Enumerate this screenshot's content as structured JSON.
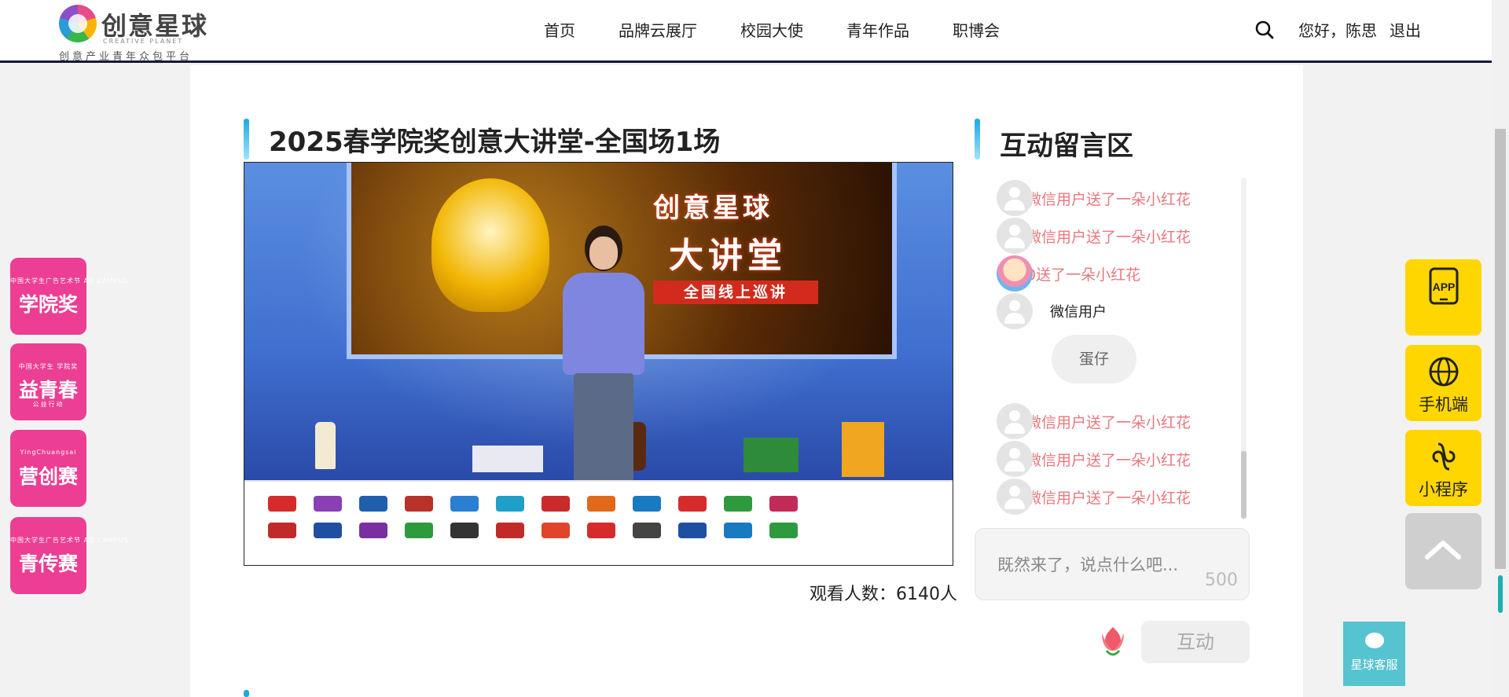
{
  "header": {
    "logo_title": "创意星球",
    "logo_en": "CREATIVE PLANET",
    "logo_sub": "创意产业青年众包平台",
    "nav": [
      "首页",
      "品牌云展厅",
      "校园大使",
      "青年作品",
      "职博会"
    ],
    "greeting": "您好，陈思",
    "logout": "退出"
  },
  "live": {
    "title": "2025春学院奖创意大讲堂-全国场1场",
    "screen_brand_line1": "创意星球",
    "screen_brand_line2": "大讲堂",
    "screen_tour": "全国线上巡讲",
    "viewers": "观看人数：6140人"
  },
  "chat": {
    "title": "互动留言区",
    "messages": [
      {
        "text": "微信用户送了一朵小红花",
        "type": "gift"
      },
      {
        "text": "微信用户送了一朵小红花",
        "type": "gift"
      },
      {
        "text": "0送了一朵小红花",
        "type": "gift"
      },
      {
        "text": "微信用户",
        "type": "user"
      },
      {
        "text": "蛋仔",
        "type": "bubble"
      },
      {
        "text": "微信用户送了一朵小红花",
        "type": "gift"
      },
      {
        "text": "微信用户送了一朵小红花",
        "type": "gift"
      },
      {
        "text": "微信用户送了一朵小红花",
        "type": "gift"
      }
    ],
    "input_placeholder": "既然来了，说点什么吧...",
    "char_count": "500",
    "send_label": "互动"
  },
  "left_floats": [
    {
      "small": "中国大学生广告艺术节 AD CAMPUS",
      "big": "学院奖",
      "tiny": ""
    },
    {
      "small": "中国大学生 学院奖",
      "big": "益青春",
      "tiny": "公益行动"
    },
    {
      "small": "YingChuangsai",
      "big": "营创赛",
      "tiny": ""
    },
    {
      "small": "中国大学生广告艺术节 AD CAMPUS",
      "big": "青传赛",
      "tiny": ""
    }
  ],
  "right_floats": [
    {
      "label": "APP",
      "icon": "app-icon"
    },
    {
      "label": "手机端",
      "icon": "globe-icon"
    },
    {
      "label": "小程序",
      "icon": "mini-program-icon"
    }
  ],
  "service": {
    "label": "星球客服",
    "icon": "chat-bubble-icon"
  },
  "colors": {
    "accent_pink": "#ec3e93",
    "accent_yellow": "#ffd600",
    "gift_text": "#e87880",
    "header_border": "#15183a",
    "service_bg": "#56c3d0"
  }
}
